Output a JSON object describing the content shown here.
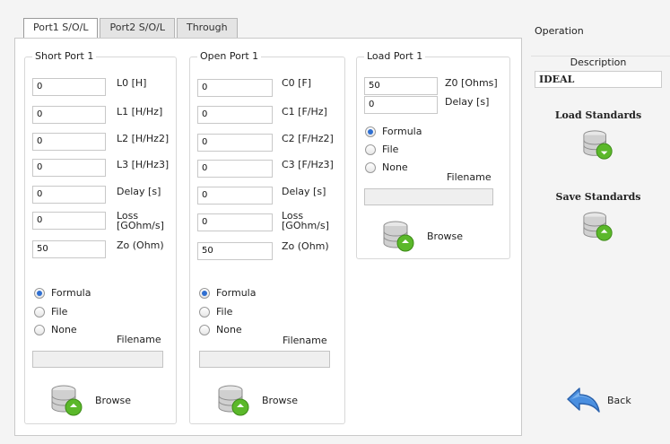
{
  "tabs": [
    "Port1 S/O/L",
    "Port2 S/O/L",
    "Through"
  ],
  "short_port": {
    "title": "Short Port 1",
    "fields": [
      {
        "value": "0",
        "label": "L0 [H]"
      },
      {
        "value": "0",
        "label": "L1 [H/Hz]"
      },
      {
        "value": "0",
        "label": "L2 [H/Hz2]"
      },
      {
        "value": "0",
        "label": "L3 [H/Hz3]"
      },
      {
        "value": "0",
        "label": "Delay [s]"
      },
      {
        "value": "0",
        "label": "Loss [GOhm/s]"
      },
      {
        "value": "50",
        "label": "Zo (Ohm)"
      }
    ],
    "radios": [
      "Formula",
      "File",
      "None"
    ],
    "selected": "Formula",
    "filename_label": "Filename",
    "browse_label": "Browse"
  },
  "open_port": {
    "title": "Open Port 1",
    "fields": [
      {
        "value": "0",
        "label": "C0 [F]"
      },
      {
        "value": "0",
        "label": "C1 [F/Hz]"
      },
      {
        "value": "0",
        "label": "C2 [F/Hz2]"
      },
      {
        "value": "0",
        "label": "C3 [F/Hz3]"
      },
      {
        "value": "0",
        "label": "Delay [s]"
      },
      {
        "value": "0",
        "label": "Loss [GOhm/s]"
      },
      {
        "value": "50",
        "label": "Zo (Ohm)"
      }
    ],
    "radios": [
      "Formula",
      "File",
      "None"
    ],
    "selected": "Formula",
    "filename_label": "Filename",
    "browse_label": "Browse"
  },
  "load_port": {
    "title": "Load Port 1",
    "fields": [
      {
        "value": "50",
        "label": "Z0 [Ohms]"
      },
      {
        "value": "0",
        "label": "Delay [s]"
      }
    ],
    "radios": [
      "Formula",
      "File",
      "None"
    ],
    "selected": "Formula",
    "filename_label": "Filename",
    "browse_label": "Browse"
  },
  "operation": {
    "title": "Operation",
    "description_label": "Description",
    "description_value": "IDEAL",
    "load_standards_label": "Load Standards",
    "save_standards_label": "Save Standards",
    "back_label": "Back"
  },
  "icons": {
    "browse": "database-green-icon",
    "load": "database-green-icon",
    "save": "database-green-icon",
    "back": "back-arrow-icon"
  },
  "colors": {
    "radio_selected": "#2f6fd1",
    "db_green": "#5bb82a",
    "back_arrow": "#4a8fe0"
  }
}
